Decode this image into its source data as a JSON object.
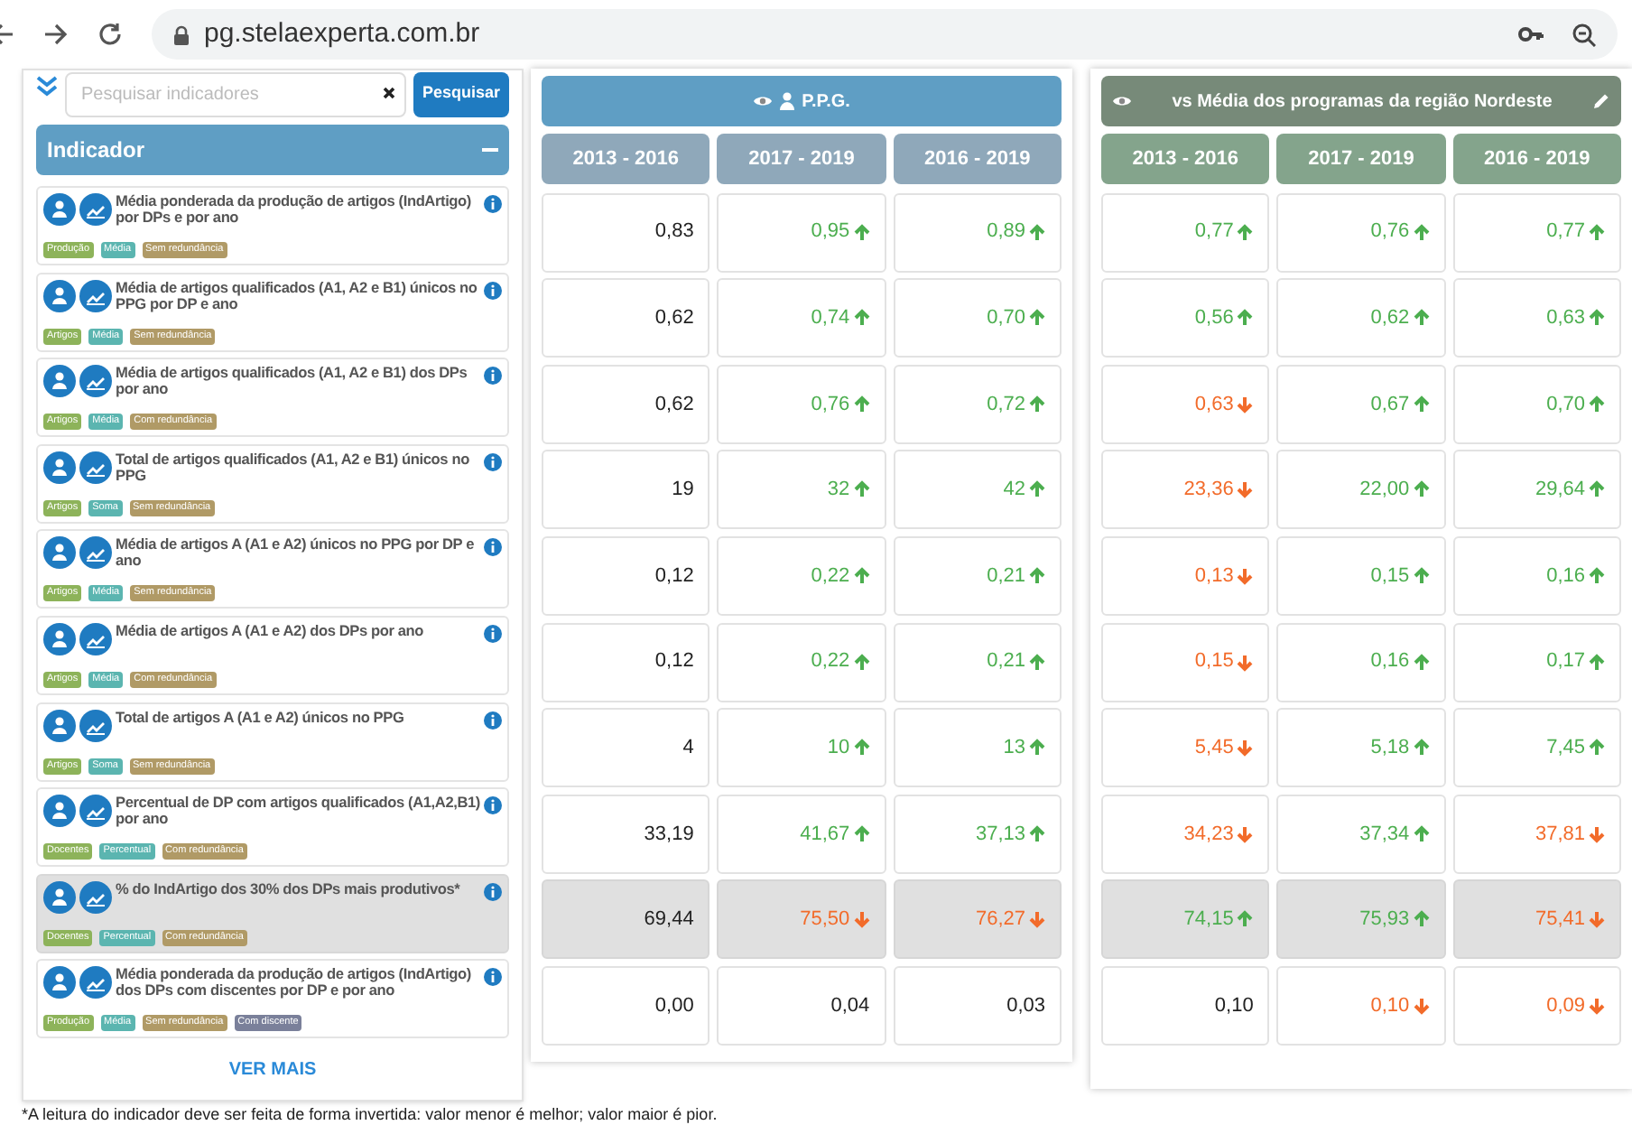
{
  "browser": {
    "url": "pg.stelaexperta.com.br"
  },
  "search": {
    "placeholder": "Pesquisar indicadores",
    "button": "Pesquisar"
  },
  "indicator_panel": {
    "title": "Indicador",
    "items": [
      {
        "text": "Média ponderada da produção de artigos (IndArtigo) por DPs e por ano",
        "selected": false,
        "tags": [
          {
            "label": "Produção",
            "color": "#8db35a"
          },
          {
            "label": "Média",
            "color": "#5bb5b0"
          },
          {
            "label": "Sem redundância",
            "color": "#b09a66"
          }
        ]
      },
      {
        "text": "Média de artigos qualificados (A1, A2 e B1) únicos no PPG por DP e ano",
        "selected": false,
        "tags": [
          {
            "label": "Artigos",
            "color": "#8db35a"
          },
          {
            "label": "Média",
            "color": "#5bb5b0"
          },
          {
            "label": "Sem redundância",
            "color": "#b09a66"
          }
        ]
      },
      {
        "text": "Média de artigos qualificados (A1, A2 e B1) dos DPs por ano",
        "selected": false,
        "tags": [
          {
            "label": "Artigos",
            "color": "#8db35a"
          },
          {
            "label": "Média",
            "color": "#5bb5b0"
          },
          {
            "label": "Com redundância",
            "color": "#b09a66"
          }
        ]
      },
      {
        "text": "Total de artigos qualificados (A1, A2 e B1) únicos no PPG",
        "selected": false,
        "tags": [
          {
            "label": "Artigos",
            "color": "#8db35a"
          },
          {
            "label": "Soma",
            "color": "#5bb5b0"
          },
          {
            "label": "Sem redundância",
            "color": "#b09a66"
          }
        ]
      },
      {
        "text": "Média de artigos A (A1 e A2) únicos no PPG por DP e ano",
        "selected": false,
        "tags": [
          {
            "label": "Artigos",
            "color": "#8db35a"
          },
          {
            "label": "Média",
            "color": "#5bb5b0"
          },
          {
            "label": "Sem redundância",
            "color": "#b09a66"
          }
        ]
      },
      {
        "text": "Média de artigos A (A1 e A2) dos DPs por ano",
        "selected": false,
        "tags": [
          {
            "label": "Artigos",
            "color": "#8db35a"
          },
          {
            "label": "Média",
            "color": "#5bb5b0"
          },
          {
            "label": "Com redundância",
            "color": "#b09a66"
          }
        ]
      },
      {
        "text": "Total de artigos A (A1 e A2) únicos no PPG",
        "selected": false,
        "tags": [
          {
            "label": "Artigos",
            "color": "#8db35a"
          },
          {
            "label": "Soma",
            "color": "#5bb5b0"
          },
          {
            "label": "Sem redundância",
            "color": "#b09a66"
          }
        ]
      },
      {
        "text": "Percentual de DP com artigos qualificados (A1,A2,B1) por ano",
        "selected": false,
        "tags": [
          {
            "label": "Docentes",
            "color": "#8db35a"
          },
          {
            "label": "Percentual",
            "color": "#5bb5b0"
          },
          {
            "label": "Com redundância",
            "color": "#b09a66"
          }
        ]
      },
      {
        "text": "% do IndArtigo dos 30% dos DPs mais produtivos*",
        "selected": true,
        "tags": [
          {
            "label": "Docentes",
            "color": "#8db35a"
          },
          {
            "label": "Percentual",
            "color": "#5bb5b0"
          },
          {
            "label": "Com redundância",
            "color": "#b09a66"
          }
        ]
      },
      {
        "text": "Média ponderada da produção de artigos (IndArtigo) dos DPs com discentes por DP e por ano",
        "selected": false,
        "tags": [
          {
            "label": "Produção",
            "color": "#8db35a"
          },
          {
            "label": "Média",
            "color": "#5bb5b0"
          },
          {
            "label": "Sem redundância",
            "color": "#b09a66"
          },
          {
            "label": "Com discente",
            "color": "#7a809a"
          }
        ]
      }
    ],
    "more_link": "VER MAIS"
  },
  "tables": [
    {
      "kind": "ppg",
      "title": "P.P.G.",
      "columns": [
        "2013 - 2016",
        "2017 - 2019",
        "2016 - 2019"
      ],
      "rows": [
        {
          "selected": false,
          "cells": [
            {
              "value": "0,83",
              "kind": "plain"
            },
            {
              "value": "0,95",
              "kind": "up"
            },
            {
              "value": "0,89",
              "kind": "up"
            }
          ]
        },
        {
          "selected": false,
          "cells": [
            {
              "value": "0,62",
              "kind": "plain"
            },
            {
              "value": "0,74",
              "kind": "up"
            },
            {
              "value": "0,70",
              "kind": "up"
            }
          ]
        },
        {
          "selected": false,
          "cells": [
            {
              "value": "0,62",
              "kind": "plain"
            },
            {
              "value": "0,76",
              "kind": "up"
            },
            {
              "value": "0,72",
              "kind": "up"
            }
          ]
        },
        {
          "selected": false,
          "cells": [
            {
              "value": "19",
              "kind": "plain"
            },
            {
              "value": "32",
              "kind": "up"
            },
            {
              "value": "42",
              "kind": "up"
            }
          ]
        },
        {
          "selected": false,
          "cells": [
            {
              "value": "0,12",
              "kind": "plain"
            },
            {
              "value": "0,22",
              "kind": "up"
            },
            {
              "value": "0,21",
              "kind": "up"
            }
          ]
        },
        {
          "selected": false,
          "cells": [
            {
              "value": "0,12",
              "kind": "plain"
            },
            {
              "value": "0,22",
              "kind": "up"
            },
            {
              "value": "0,21",
              "kind": "up"
            }
          ]
        },
        {
          "selected": false,
          "cells": [
            {
              "value": "4",
              "kind": "plain"
            },
            {
              "value": "10",
              "kind": "up"
            },
            {
              "value": "13",
              "kind": "up"
            }
          ]
        },
        {
          "selected": false,
          "cells": [
            {
              "value": "33,19",
              "kind": "plain"
            },
            {
              "value": "41,67",
              "kind": "up"
            },
            {
              "value": "37,13",
              "kind": "up"
            }
          ]
        },
        {
          "selected": true,
          "cells": [
            {
              "value": "69,44",
              "kind": "plain"
            },
            {
              "value": "75,50",
              "kind": "down"
            },
            {
              "value": "76,27",
              "kind": "down"
            }
          ]
        },
        {
          "selected": false,
          "cells": [
            {
              "value": "0,00",
              "kind": "plain"
            },
            {
              "value": "0,04",
              "kind": "plain"
            },
            {
              "value": "0,03",
              "kind": "plain"
            }
          ]
        }
      ]
    },
    {
      "kind": "region",
      "title": "vs Média dos programas da região Nordeste",
      "columns": [
        "2013 - 2016",
        "2017 - 2019",
        "2016 - 2019"
      ],
      "rows": [
        {
          "selected": false,
          "cells": [
            {
              "value": "0,77",
              "kind": "up"
            },
            {
              "value": "0,76",
              "kind": "up"
            },
            {
              "value": "0,77",
              "kind": "up"
            }
          ]
        },
        {
          "selected": false,
          "cells": [
            {
              "value": "0,56",
              "kind": "up"
            },
            {
              "value": "0,62",
              "kind": "up"
            },
            {
              "value": "0,63",
              "kind": "up"
            }
          ]
        },
        {
          "selected": false,
          "cells": [
            {
              "value": "0,63",
              "kind": "down"
            },
            {
              "value": "0,67",
              "kind": "up"
            },
            {
              "value": "0,70",
              "kind": "up"
            }
          ]
        },
        {
          "selected": false,
          "cells": [
            {
              "value": "23,36",
              "kind": "down"
            },
            {
              "value": "22,00",
              "kind": "up"
            },
            {
              "value": "29,64",
              "kind": "up"
            }
          ]
        },
        {
          "selected": false,
          "cells": [
            {
              "value": "0,13",
              "kind": "down"
            },
            {
              "value": "0,15",
              "kind": "up"
            },
            {
              "value": "0,16",
              "kind": "up"
            }
          ]
        },
        {
          "selected": false,
          "cells": [
            {
              "value": "0,15",
              "kind": "down"
            },
            {
              "value": "0,16",
              "kind": "up"
            },
            {
              "value": "0,17",
              "kind": "up"
            }
          ]
        },
        {
          "selected": false,
          "cells": [
            {
              "value": "5,45",
              "kind": "down"
            },
            {
              "value": "5,18",
              "kind": "up"
            },
            {
              "value": "7,45",
              "kind": "up"
            }
          ]
        },
        {
          "selected": false,
          "cells": [
            {
              "value": "34,23",
              "kind": "down"
            },
            {
              "value": "37,34",
              "kind": "up"
            },
            {
              "value": "37,81",
              "kind": "down"
            }
          ]
        },
        {
          "selected": true,
          "cells": [
            {
              "value": "74,15",
              "kind": "up"
            },
            {
              "value": "75,93",
              "kind": "up"
            },
            {
              "value": "75,41",
              "kind": "down"
            }
          ]
        },
        {
          "selected": false,
          "cells": [
            {
              "value": "0,10",
              "kind": "plain"
            },
            {
              "value": "0,10",
              "kind": "down"
            },
            {
              "value": "0,09",
              "kind": "down"
            }
          ]
        }
      ]
    }
  ],
  "footnote": "*A leitura do indicador deve ser feita de forma invertida: valor menor é melhor; valor maior é pior."
}
